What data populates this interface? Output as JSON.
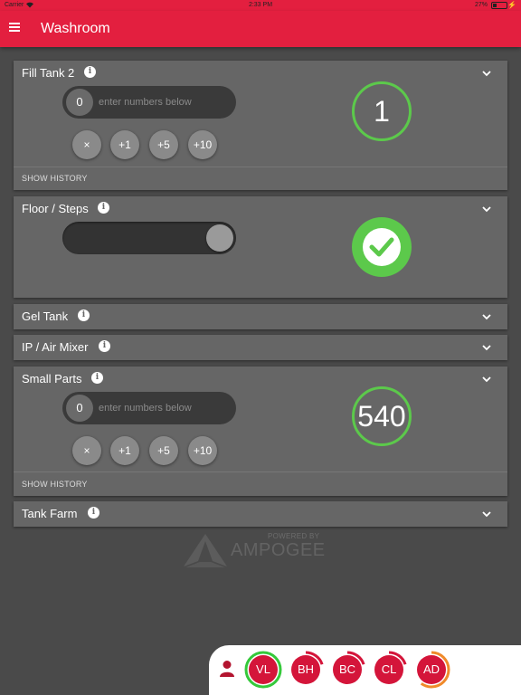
{
  "status": {
    "carrier": "Carrier",
    "time": "2:33 PM",
    "battery": "27%"
  },
  "appbar": {
    "title": "Washroom",
    "menu_icon": "hamburger-menu-icon"
  },
  "colors": {
    "accent": "#e31f3f",
    "card": "#666666",
    "background": "#4a4a4a",
    "success": "#5cc94b",
    "avatar": "#d4153a"
  },
  "cards": {
    "fill_tank_2": {
      "title": "Fill Tank 2",
      "entry_value": "0",
      "entry_placeholder": "enter numbers below",
      "buttons": [
        "×",
        "+1",
        "+5",
        "+10"
      ],
      "count": "1",
      "history": "SHOW HISTORY"
    },
    "floor_steps": {
      "title": "Floor / Steps",
      "toggle_on": true,
      "done": true
    },
    "gel_tank": {
      "title": "Gel Tank"
    },
    "ip_air_mixer": {
      "title": "IP / Air Mixer"
    },
    "small_parts": {
      "title": "Small Parts",
      "entry_value": "0",
      "entry_placeholder": "enter numbers below",
      "buttons": [
        "×",
        "+1",
        "+5",
        "+10"
      ],
      "count": "540",
      "history": "SHOW HISTORY"
    },
    "tank_farm": {
      "title": "Tank Farm"
    }
  },
  "brand": {
    "powered": "POWERED BY",
    "name": "AMPOGEE"
  },
  "users": [
    {
      "initials": "VL",
      "ring_color": "#35c93b",
      "progress": 1.0
    },
    {
      "initials": "BH",
      "ring_color": "#d4153a",
      "progress": 0.2
    },
    {
      "initials": "BC",
      "ring_color": "#d4153a",
      "progress": 0.2
    },
    {
      "initials": "CL",
      "ring_color": "#d4153a",
      "progress": 0.2
    },
    {
      "initials": "AD",
      "ring_color": "#f08a2a",
      "progress": 0.6
    }
  ]
}
